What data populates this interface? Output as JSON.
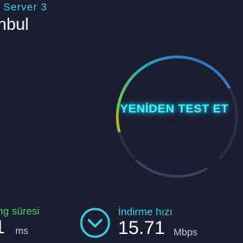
{
  "server": {
    "name": "r Server 3",
    "city": "nbul"
  },
  "retest": {
    "label": "YENİDEN TEST ET"
  },
  "ping": {
    "label": "ng süresi",
    "value": "1",
    "unit": "ms"
  },
  "download": {
    "label": "İndirme hızı",
    "value": "15.71",
    "unit": "Mbps",
    "icon": "download-chevron-icon"
  },
  "colors": {
    "background": "#1b1d30",
    "accent": "#35d3e6",
    "ping_accent": "#49d36c",
    "button_text": "#3ff3ff",
    "gauge_start": "#3a4fd6",
    "gauge_mid": "#7cd24a",
    "gauge_end": "#e8443a"
  }
}
